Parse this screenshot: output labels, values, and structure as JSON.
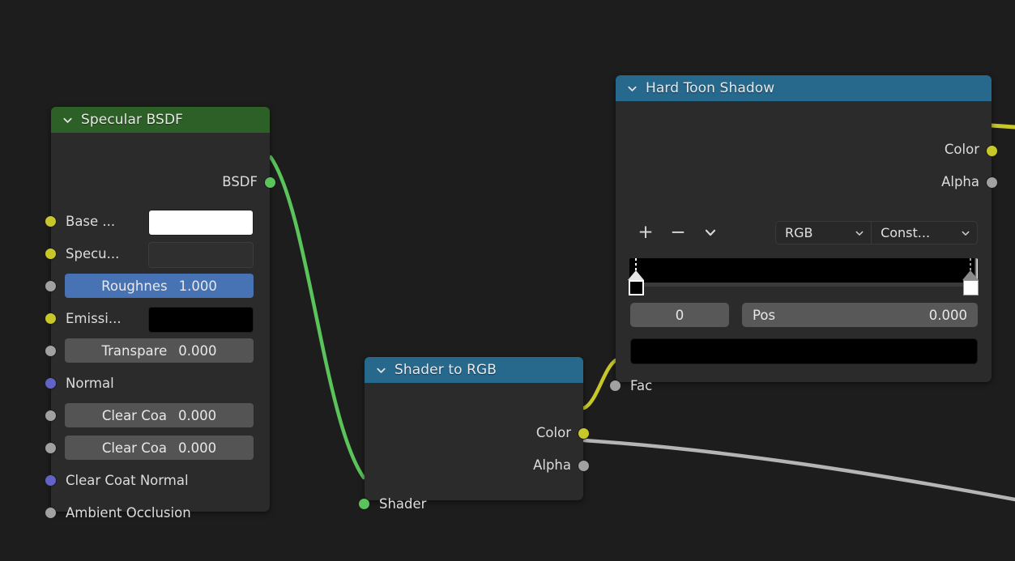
{
  "editor": {
    "background_color": "#1d1d1d",
    "name": "blender-shader-node-editor"
  },
  "nodes": [
    {
      "id": "specular-bsdf",
      "title": "Specular BSDF",
      "header_color": "#2d6026",
      "outputs": [
        {
          "label": "BSDF",
          "socket_color": "#5ac35a",
          "type": "shader"
        }
      ],
      "inputs": [
        {
          "label": "Base ...",
          "socket_color": "#c7c729",
          "widget": "color",
          "value": "#ffffff"
        },
        {
          "label": "Specu...",
          "socket_color": "#c7c729",
          "widget": "color",
          "value": "#2f2f2f"
        },
        {
          "label": "Roughnes",
          "socket_color": "#a1a1a1",
          "widget": "slider",
          "value": "1.000",
          "fill": 1.0
        },
        {
          "label": "Emissi...",
          "socket_color": "#c7c729",
          "widget": "color",
          "value": "#000000"
        },
        {
          "label": "Transpare",
          "socket_color": "#a1a1a1",
          "widget": "slider",
          "value": "0.000",
          "fill": 0.0
        },
        {
          "label": "Normal",
          "socket_color": "#6363c7",
          "widget": "none",
          "value": ""
        },
        {
          "label": "Clear Coa",
          "socket_color": "#a1a1a1",
          "widget": "slider",
          "value": "0.000",
          "fill": 0.0
        },
        {
          "label": "Clear Coa",
          "socket_color": "#a1a1a1",
          "widget": "slider",
          "value": "0.000",
          "fill": 0.0
        },
        {
          "label": "Clear Coat Normal",
          "socket_color": "#6363c7",
          "widget": "none",
          "value": ""
        },
        {
          "label": "Ambient Occlusion",
          "socket_color": "#a1a1a1",
          "widget": "none",
          "value": ""
        }
      ]
    },
    {
      "id": "shader-to-rgb",
      "title": "Shader to RGB",
      "header_color": "#27688d",
      "outputs": [
        {
          "label": "Color",
          "socket_color": "#c7c729"
        },
        {
          "label": "Alpha",
          "socket_color": "#a1a1a1"
        }
      ],
      "inputs": [
        {
          "label": "Shader",
          "socket_color": "#5ac35a"
        }
      ]
    },
    {
      "id": "hard-toon-shadow",
      "title": "Hard Toon Shadow",
      "header_color": "#27688d",
      "outputs": [
        {
          "label": "Color",
          "socket_color": "#c7c729"
        },
        {
          "label": "Alpha",
          "socket_color": "#a1a1a1"
        }
      ],
      "inputs": [
        {
          "label": "Fac",
          "socket_color": "#a1a1a1"
        }
      ],
      "color_ramp": {
        "add_label": "+",
        "remove_label": "−",
        "menu_icon": "chevron-down-icon",
        "color_mode": "RGB",
        "interpolation": "Const...",
        "active_index": "0",
        "pos_label": "Pos",
        "pos_value": "0.000",
        "active_color": "#000000",
        "stops": [
          {
            "position": 0.0,
            "color": "#000000",
            "selected": true
          },
          {
            "position": 1.0,
            "color": "#ffffff",
            "selected": false
          }
        ]
      }
    }
  ],
  "links": [
    {
      "from": "specular-bsdf.BSDF",
      "to": "shader-to-rgb.Shader",
      "color": "#5ac35a"
    },
    {
      "from": "shader-to-rgb.Color",
      "to": "hard-toon-shadow.Fac",
      "color": "#c7c729"
    },
    {
      "from": "shader-to-rgb.Alpha",
      "to": "offscreen",
      "color": "#b5b5b5"
    },
    {
      "from": "hard-toon-shadow.Color",
      "to": "offscreen",
      "color": "#c7c729"
    }
  ]
}
